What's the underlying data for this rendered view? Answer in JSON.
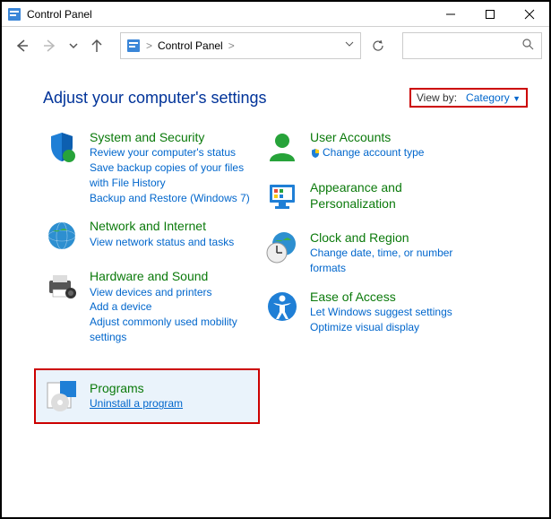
{
  "window": {
    "title": "Control Panel"
  },
  "address": {
    "path": "Control Panel",
    "separator": ">"
  },
  "heading": "Adjust your computer's settings",
  "viewby": {
    "label": "View by:",
    "value": "Category",
    "caret": "▼"
  },
  "categories": {
    "system": {
      "title": "System and Security",
      "links": [
        "Review your computer's status",
        "Save backup copies of your files with File History",
        "Backup and Restore (Windows 7)"
      ]
    },
    "network": {
      "title": "Network and Internet",
      "links": [
        "View network status and tasks"
      ]
    },
    "hardware": {
      "title": "Hardware and Sound",
      "links": [
        "View devices and printers",
        "Add a device",
        "Adjust commonly used mobility settings"
      ]
    },
    "programs": {
      "title": "Programs",
      "links": [
        "Uninstall a program"
      ]
    },
    "users": {
      "title": "User Accounts",
      "links": [
        "Change account type"
      ]
    },
    "appearance": {
      "title": "Appearance and Personalization"
    },
    "clock": {
      "title": "Clock and Region",
      "links": [
        "Change date, time, or number formats"
      ]
    },
    "ease": {
      "title": "Ease of Access",
      "links": [
        "Let Windows suggest settings",
        "Optimize visual display"
      ]
    }
  }
}
